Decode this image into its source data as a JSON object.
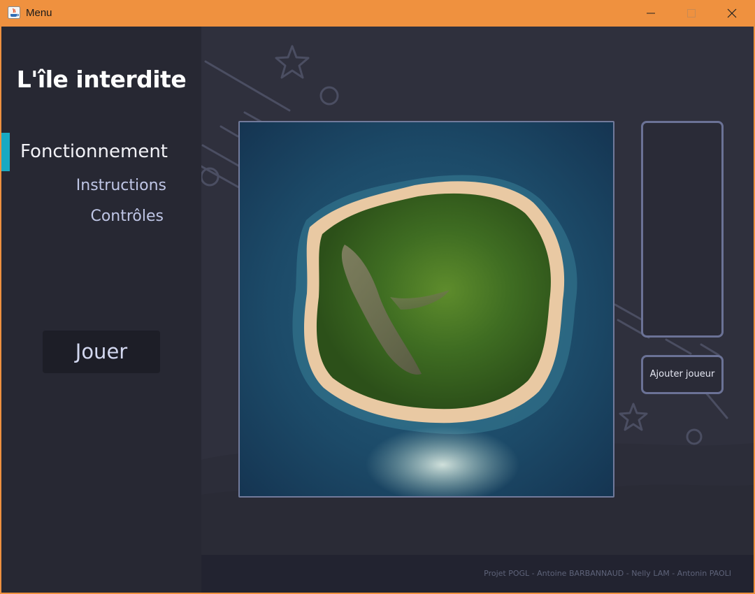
{
  "window": {
    "title": "Menu"
  },
  "sidebar": {
    "game_title": "L'île interdite",
    "nav": {
      "active": "Fonctionnement",
      "items": [
        "Instructions",
        "Contrôles"
      ]
    },
    "play_label": "Jouer"
  },
  "main": {
    "add_player_label": "Ajouter joueur",
    "credits": "Projet POGL - Antoine BARBANNAUD - Nelly LAM - Antonin PAOLI"
  },
  "colors": {
    "titlebar": "#ef913f",
    "accent": "#19a9c2",
    "sidebar_bg": "#272833",
    "main_bg": "#2f303d"
  }
}
